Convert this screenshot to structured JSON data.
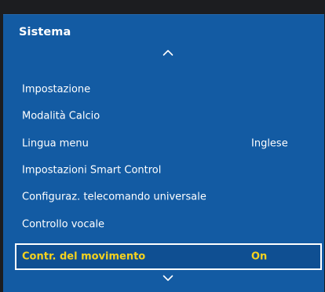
{
  "menu": {
    "title": "Sistema",
    "items": [
      {
        "label": "Impostazione",
        "value": ""
      },
      {
        "label": "Modalità Calcio",
        "value": ""
      },
      {
        "label": "Lingua menu",
        "value": "Inglese"
      },
      {
        "label": "Impostazioni Smart Control",
        "value": ""
      },
      {
        "label": "Configuraz. telecomando universale",
        "value": ""
      },
      {
        "label": "Controllo vocale",
        "value": ""
      },
      {
        "label": "Contr. del movimento",
        "value": "On"
      }
    ],
    "selected_index": 6
  },
  "colors": {
    "panel": "#135ba3",
    "frame": "#1c1d20",
    "highlight_text": "#f5d21e",
    "text": "#ffffff"
  },
  "icons": {
    "scroll_up": "chevron-up-icon",
    "scroll_down": "chevron-down-icon"
  }
}
